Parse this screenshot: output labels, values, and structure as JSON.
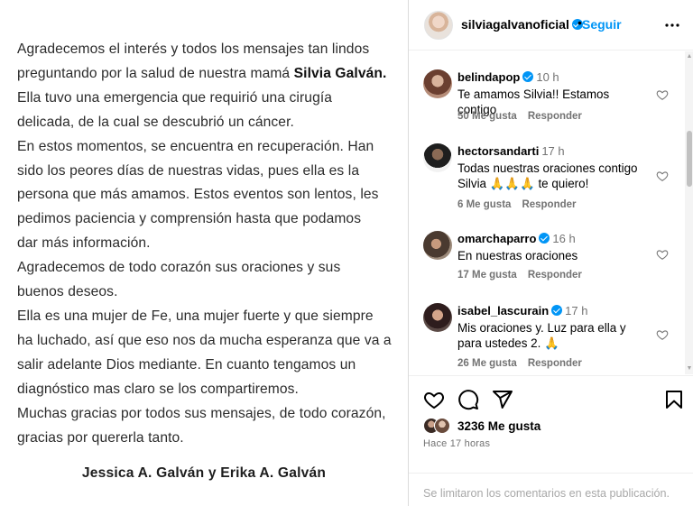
{
  "post": {
    "statement_lines": [
      "Agradecemos el interés y todos los mensajes tan lindos",
      "preguntando por la salud de nuestra mamá ",
      "Ella tuvo una emergencia que requirió una cirugía",
      "delicada, de la cual se descubrió un cáncer.",
      "En estos momentos, se encuentra en recuperación. Han",
      "sido los peores días de nuestras vidas, pues ella es la",
      "persona que más amamos. Estos eventos son lentos, les",
      "pedimos paciencia y comprensión hasta que podamos",
      "dar más información.",
      "Agradecemos de todo corazón sus oraciones y sus",
      "buenos deseos.",
      "Ella es una mujer de Fe, una mujer fuerte y que siempre",
      "ha luchado, así que eso nos da mucha esperanza que va a",
      "salir adelante Dios mediante. En cuanto tengamos un",
      "diagnóstico mas claro se los compartiremos.",
      "Muchas gracias por todos sus mensajes, de todo corazón,",
      "gracias por quererla tanto."
    ],
    "highlighted_name": "Silvia Galván.",
    "signature": "Jessica A. Galván y Erika A. Galván"
  },
  "header": {
    "username": "silviagalvanoficial",
    "separator": "•",
    "follow_label": "Seguir",
    "more_icon": "more-horizontal-icon"
  },
  "comments": [
    {
      "username": "belindapop",
      "verified": true,
      "time": "10 h",
      "text": "Te amamos Silvia!! Estamos contigo",
      "likes": "50 Me gusta",
      "reply": "Responder",
      "avatar_color": "#8a5a4a"
    },
    {
      "username": "hectorsandarti",
      "verified": false,
      "time": "17 h",
      "text": "Todas nuestras oraciones contigo Silvia 🙏🙏🙏 te quiero!",
      "likes": "6 Me gusta",
      "reply": "Responder",
      "avatar_color": "#2a2a2a"
    },
    {
      "username": "omarchaparro",
      "verified": true,
      "time": "16 h",
      "text": "En nuestras oraciones",
      "likes": "17 Me gusta",
      "reply": "Responder",
      "avatar_color": "#5b4a3e"
    },
    {
      "username": "isabel_lascurain",
      "verified": true,
      "time": "17 h",
      "text": "Mis oraciones y. Luz para ella y para ustedes 2. 🙏",
      "likes": "26 Me gusta",
      "reply": "Responder",
      "avatar_color": "#3b2a2a"
    }
  ],
  "actions": {
    "likes_count": "3236 Me gusta",
    "post_time": "Hace 17 horas",
    "comments_limited": "Se limitaron los comentarios en esta publicación."
  },
  "colors": {
    "accent": "#0095f6",
    "muted": "#737373",
    "border": "#dbdbdb"
  }
}
